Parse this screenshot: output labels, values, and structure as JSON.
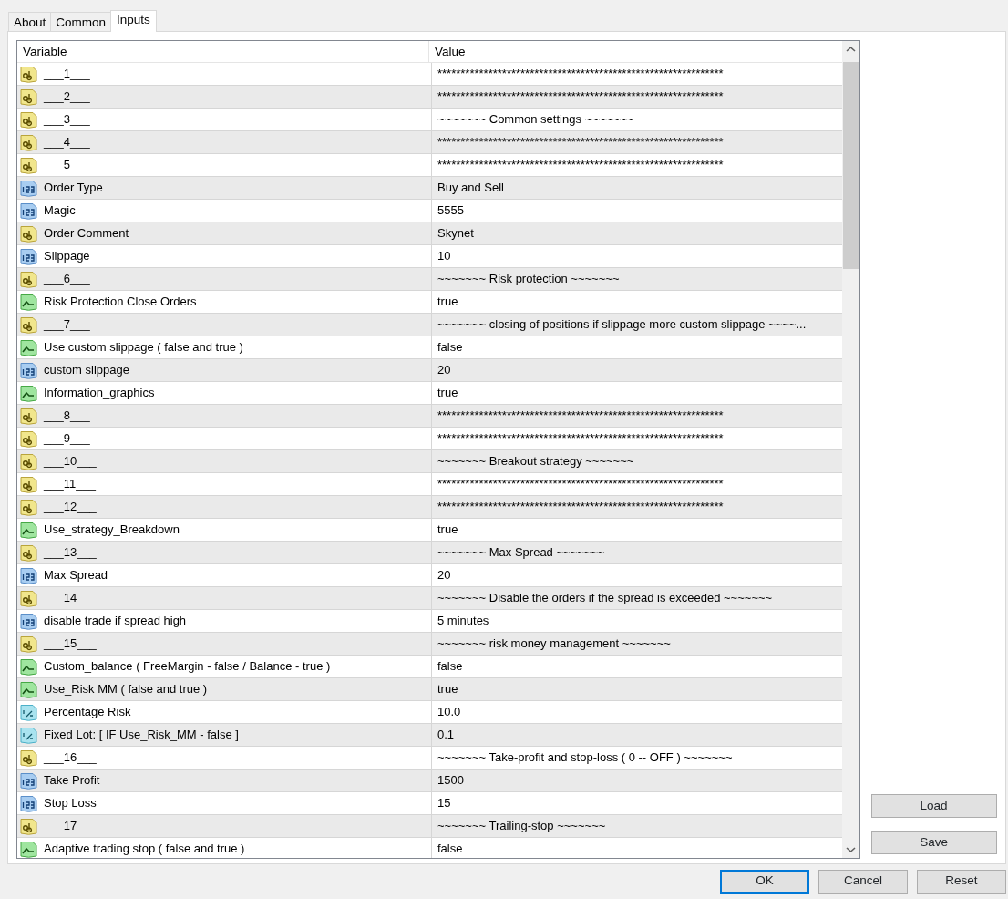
{
  "tabs": [
    {
      "label": "About",
      "selected": false
    },
    {
      "label": "Common",
      "selected": false
    },
    {
      "label": "Inputs",
      "selected": true
    }
  ],
  "table": {
    "columns": [
      "Variable",
      "Value"
    ],
    "rows": [
      {
        "kind": "string",
        "variable": "___1___",
        "value": "**************************************************************"
      },
      {
        "kind": "string",
        "variable": "___2___",
        "value": "**************************************************************"
      },
      {
        "kind": "string",
        "variable": "___3___",
        "value": "~~~~~~~ Common settings ~~~~~~~"
      },
      {
        "kind": "string",
        "variable": "___4___",
        "value": "**************************************************************"
      },
      {
        "kind": "string",
        "variable": "___5___",
        "value": "**************************************************************"
      },
      {
        "kind": "int",
        "variable": "Order Type",
        "value": "Buy and Sell"
      },
      {
        "kind": "int",
        "variable": "Magic",
        "value": "5555"
      },
      {
        "kind": "string",
        "variable": "Order Comment",
        "value": "Skynet"
      },
      {
        "kind": "int",
        "variable": "Slippage",
        "value": "10"
      },
      {
        "kind": "string",
        "variable": "___6___",
        "value": "~~~~~~~ Risk protection ~~~~~~~"
      },
      {
        "kind": "bool",
        "variable": "Risk Protection Close Orders",
        "value": "true"
      },
      {
        "kind": "string",
        "variable": "___7___",
        "value": "~~~~~~~ closing of positions if slippage more custom slippage ~~~~..."
      },
      {
        "kind": "bool",
        "variable": "Use custom slippage ( false and true )",
        "value": "false"
      },
      {
        "kind": "int",
        "variable": "custom slippage",
        "value": "20"
      },
      {
        "kind": "bool",
        "variable": "Information_graphics",
        "value": "true"
      },
      {
        "kind": "string",
        "variable": "___8___",
        "value": "**************************************************************"
      },
      {
        "kind": "string",
        "variable": "___9___",
        "value": "**************************************************************"
      },
      {
        "kind": "string",
        "variable": "___10___",
        "value": "~~~~~~~ Breakout strategy ~~~~~~~"
      },
      {
        "kind": "string",
        "variable": "___11___",
        "value": "**************************************************************"
      },
      {
        "kind": "string",
        "variable": "___12___",
        "value": "**************************************************************"
      },
      {
        "kind": "bool",
        "variable": "Use_strategy_Breakdown",
        "value": "true"
      },
      {
        "kind": "string",
        "variable": "___13___",
        "value": "~~~~~~~ Max Spread ~~~~~~~"
      },
      {
        "kind": "int",
        "variable": "Max Spread",
        "value": "20"
      },
      {
        "kind": "string",
        "variable": "___14___",
        "value": "~~~~~~~ Disable the orders if the spread is exceeded ~~~~~~~"
      },
      {
        "kind": "int",
        "variable": "disable trade if spread high",
        "value": "5 minutes"
      },
      {
        "kind": "string",
        "variable": "___15___",
        "value": "~~~~~~~ risk money management ~~~~~~~"
      },
      {
        "kind": "bool",
        "variable": "Custom_balance ( FreeMargin - false / Balance - true )",
        "value": "false"
      },
      {
        "kind": "bool",
        "variable": "Use_Risk MM ( false and true )",
        "value": "true"
      },
      {
        "kind": "double",
        "variable": "Percentage Risk",
        "value": "10.0"
      },
      {
        "kind": "double",
        "variable": "Fixed Lot: [ IF  Use_Risk_MM - false ]",
        "value": "0.1"
      },
      {
        "kind": "string",
        "variable": "___16___",
        "value": "~~~~~~~ Take-profit and stop-loss ( 0 -- OFF ) ~~~~~~~"
      },
      {
        "kind": "int",
        "variable": "Take Profit",
        "value": "1500"
      },
      {
        "kind": "int",
        "variable": "Stop Loss",
        "value": "15"
      },
      {
        "kind": "string",
        "variable": "___17___",
        "value": "~~~~~~~ Trailing-stop ~~~~~~~"
      },
      {
        "kind": "bool",
        "variable": "Adaptive trading stop ( false and true )",
        "value": "false"
      }
    ]
  },
  "side_buttons": [
    "Load",
    "Save"
  ],
  "buttons": [
    {
      "label": "OK",
      "focused": true
    },
    {
      "label": "Cancel",
      "focused": false
    },
    {
      "label": "Reset",
      "focused": false
    }
  ]
}
